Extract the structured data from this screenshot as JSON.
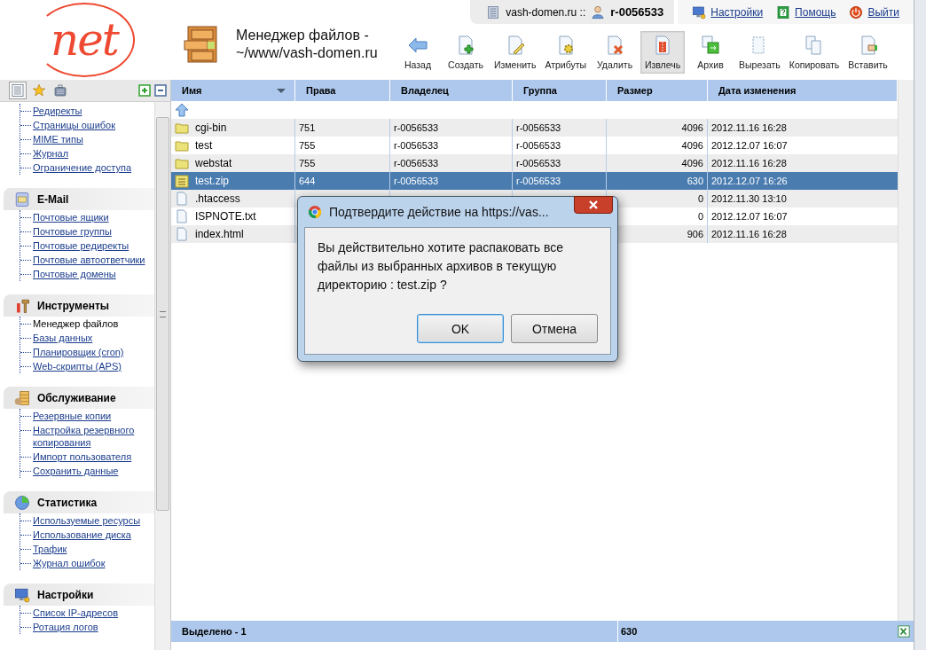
{
  "logo": "net",
  "title": {
    "line1": "Менеджер файлов -",
    "line2": "~/www/vash-domen.ru"
  },
  "account": {
    "domain": "vash-domen.ru ::",
    "user": "r-0056533"
  },
  "top_links": [
    {
      "label": "Настройки",
      "kind": "settings"
    },
    {
      "label": "Помощь",
      "kind": "help"
    },
    {
      "label": "Выйти",
      "kind": "logout"
    }
  ],
  "toolbar": [
    {
      "label": "Назад",
      "kind": "back",
      "pressed": false
    },
    {
      "label": "Создать",
      "kind": "create",
      "pressed": false
    },
    {
      "label": "Изменить",
      "kind": "edit",
      "pressed": false
    },
    {
      "label": "Атрибуты",
      "kind": "attrs",
      "pressed": false
    },
    {
      "label": "Удалить",
      "kind": "delete",
      "pressed": false
    },
    {
      "label": "Извлечь",
      "kind": "extract",
      "pressed": true
    },
    {
      "label": "Архив",
      "kind": "archive",
      "pressed": false
    },
    {
      "label": "Вырезать",
      "kind": "cut",
      "pressed": false
    },
    {
      "label": "Копировать",
      "kind": "copy",
      "pressed": false
    },
    {
      "label": "Вставить",
      "kind": "paste",
      "pressed": false
    }
  ],
  "sidebar": {
    "tabs": [
      {
        "kind": "list",
        "selected": true
      },
      {
        "kind": "star",
        "selected": false
      },
      {
        "kind": "case",
        "selected": false
      }
    ],
    "sections": [
      {
        "items": [
          {
            "label": "Редиректы",
            "selected": false
          },
          {
            "label": "Страницы ошибок",
            "selected": false
          },
          {
            "label": "MIME типы",
            "selected": false
          },
          {
            "label": "Журнал",
            "selected": false
          },
          {
            "label": "Ограничение доступа",
            "selected": false
          }
        ]
      },
      {
        "title": "E-Mail",
        "kind": "mail",
        "items": [
          {
            "label": "Почтовые ящики",
            "selected": false
          },
          {
            "label": "Почтовые группы",
            "selected": false
          },
          {
            "label": "Почтовые редиректы",
            "selected": false
          },
          {
            "label": "Почтовые автоответчики",
            "selected": false
          },
          {
            "label": "Почтовые домены",
            "selected": false
          }
        ]
      },
      {
        "title": "Инструменты",
        "kind": "tools",
        "items": [
          {
            "label": "Менеджер файлов",
            "selected": true
          },
          {
            "label": "Базы данных",
            "selected": false
          },
          {
            "label": "Планировщик (cron)",
            "selected": false
          },
          {
            "label": "Web-скрипты (APS)",
            "selected": false
          }
        ]
      },
      {
        "title": "Обслуживание",
        "kind": "service",
        "items": [
          {
            "label": "Резервные копии",
            "selected": false
          },
          {
            "label": "Настройка резервного копирования",
            "selected": false
          },
          {
            "label": "Импорт пользователя",
            "selected": false
          },
          {
            "label": "Сохранить данные",
            "selected": false
          }
        ]
      },
      {
        "title": "Статистика",
        "kind": "stats",
        "items": [
          {
            "label": "Используемые ресурсы",
            "selected": false
          },
          {
            "label": "Использование диска",
            "selected": false
          },
          {
            "label": "Трафик",
            "selected": false
          },
          {
            "label": "Журнал ошибок",
            "selected": false
          }
        ]
      },
      {
        "title": "Настройки",
        "kind": "settings",
        "items": [
          {
            "label": "Список IP-адресов",
            "selected": false
          },
          {
            "label": "Ротация логов",
            "selected": false
          }
        ]
      }
    ]
  },
  "table": {
    "columns": [
      "Имя",
      "Права",
      "Владелец",
      "Группа",
      "Размер",
      "Дата изменения"
    ],
    "rows": [
      {
        "kind": "folder",
        "name": "cgi-bin",
        "perms": "751",
        "owner": "r-0056533",
        "group": "r-0056533",
        "size": "4096",
        "date": "2012.11.16 16:28",
        "selected": false
      },
      {
        "kind": "folder",
        "name": "test",
        "perms": "755",
        "owner": "r-0056533",
        "group": "r-0056533",
        "size": "4096",
        "date": "2012.12.07 16:07",
        "selected": false
      },
      {
        "kind": "folder",
        "name": "webstat",
        "perms": "755",
        "owner": "r-0056533",
        "group": "r-0056533",
        "size": "4096",
        "date": "2012.11.16 16:28",
        "selected": false
      },
      {
        "kind": "zip",
        "name": "test.zip",
        "perms": "644",
        "owner": "r-0056533",
        "group": "r-0056533",
        "size": "630",
        "date": "2012.12.07 16:26",
        "selected": true
      },
      {
        "kind": "file",
        "name": ".htaccess",
        "size": "0",
        "date": "2012.11.30 13:10",
        "selected": false
      },
      {
        "kind": "file",
        "name": "ISPNOTE.txt",
        "size": "0",
        "date": "2012.12.07 16:07",
        "selected": false
      },
      {
        "kind": "file",
        "name": "index.html",
        "size": "906",
        "date": "2012.11.16 16:28",
        "selected": false
      }
    ],
    "footer": {
      "selected_count": "Выделено - 1",
      "size": "630"
    }
  },
  "dialog": {
    "title": "Подтвердите действие на https://vas...",
    "message": "Вы действительно хотите распаковать все файлы из выбранных архивов в текущую директорию :  test.zip ?",
    "buttons": [
      {
        "label": "OK",
        "default": true
      },
      {
        "label": "Отмена",
        "default": false
      }
    ]
  }
}
